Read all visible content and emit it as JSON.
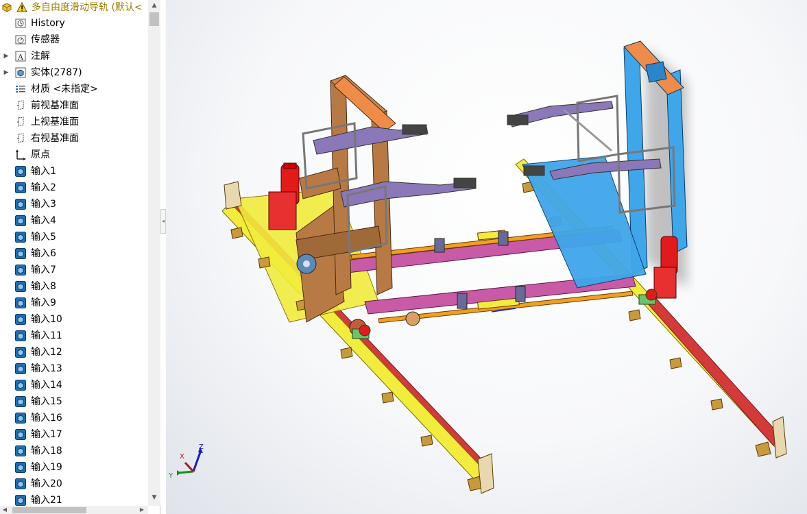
{
  "header": {
    "title": "多自由度滑动导轨 (默认<"
  },
  "tree": {
    "items": [
      {
        "label": "History",
        "icon": "history-icon",
        "expandable": false
      },
      {
        "label": "传感器",
        "icon": "sensor-icon",
        "expandable": false
      },
      {
        "label": "注解",
        "icon": "annotation-icon",
        "expandable": true
      },
      {
        "label": "实体(2787)",
        "icon": "solid-bodies-icon",
        "expandable": true
      },
      {
        "label": "材质 <未指定>",
        "icon": "material-icon",
        "expandable": false
      },
      {
        "label": "前视基准面",
        "icon": "plane-icon",
        "expandable": false
      },
      {
        "label": "上视基准面",
        "icon": "plane-icon",
        "expandable": false
      },
      {
        "label": "右视基准面",
        "icon": "plane-icon",
        "expandable": false
      },
      {
        "label": "原点",
        "icon": "origin-icon",
        "expandable": false
      },
      {
        "label": "输入1",
        "icon": "imported-body-icon",
        "expandable": false
      },
      {
        "label": "输入2",
        "icon": "imported-body-icon",
        "expandable": false
      },
      {
        "label": "输入3",
        "icon": "imported-body-icon",
        "expandable": false
      },
      {
        "label": "输入4",
        "icon": "imported-body-icon",
        "expandable": false
      },
      {
        "label": "输入5",
        "icon": "imported-body-icon",
        "expandable": false
      },
      {
        "label": "输入6",
        "icon": "imported-body-icon",
        "expandable": false
      },
      {
        "label": "输入7",
        "icon": "imported-body-icon",
        "expandable": false
      },
      {
        "label": "输入8",
        "icon": "imported-body-icon",
        "expandable": false
      },
      {
        "label": "输入9",
        "icon": "imported-body-icon",
        "expandable": false
      },
      {
        "label": "输入10",
        "icon": "imported-body-icon",
        "expandable": false
      },
      {
        "label": "输入11",
        "icon": "imported-body-icon",
        "expandable": false
      },
      {
        "label": "输入12",
        "icon": "imported-body-icon",
        "expandable": false
      },
      {
        "label": "输入13",
        "icon": "imported-body-icon",
        "expandable": false
      },
      {
        "label": "输入14",
        "icon": "imported-body-icon",
        "expandable": false
      },
      {
        "label": "输入15",
        "icon": "imported-body-icon",
        "expandable": false
      },
      {
        "label": "输入16",
        "icon": "imported-body-icon",
        "expandable": false
      },
      {
        "label": "输入17",
        "icon": "imported-body-icon",
        "expandable": false
      },
      {
        "label": "输入18",
        "icon": "imported-body-icon",
        "expandable": false
      },
      {
        "label": "输入19",
        "icon": "imported-body-icon",
        "expandable": false
      },
      {
        "label": "输入20",
        "icon": "imported-body-icon",
        "expandable": false
      },
      {
        "label": "输入21",
        "icon": "imported-body-icon",
        "expandable": false
      }
    ]
  },
  "triad": {
    "x": "X",
    "y": "Y",
    "z": "Z"
  },
  "colors": {
    "rail_yellow": "#f2ec3c",
    "rail_red": "#d43a3a",
    "frame_brown": "#b87a45",
    "column_blue": "#3fa6ea",
    "beam_magenta": "#c85aa6",
    "shaft_orange": "#f0a020",
    "motor_red": "#e21a1a",
    "cap_orange": "#f08c4a",
    "arm_purple": "#8a78b8",
    "header_text": "#9a7e00"
  }
}
